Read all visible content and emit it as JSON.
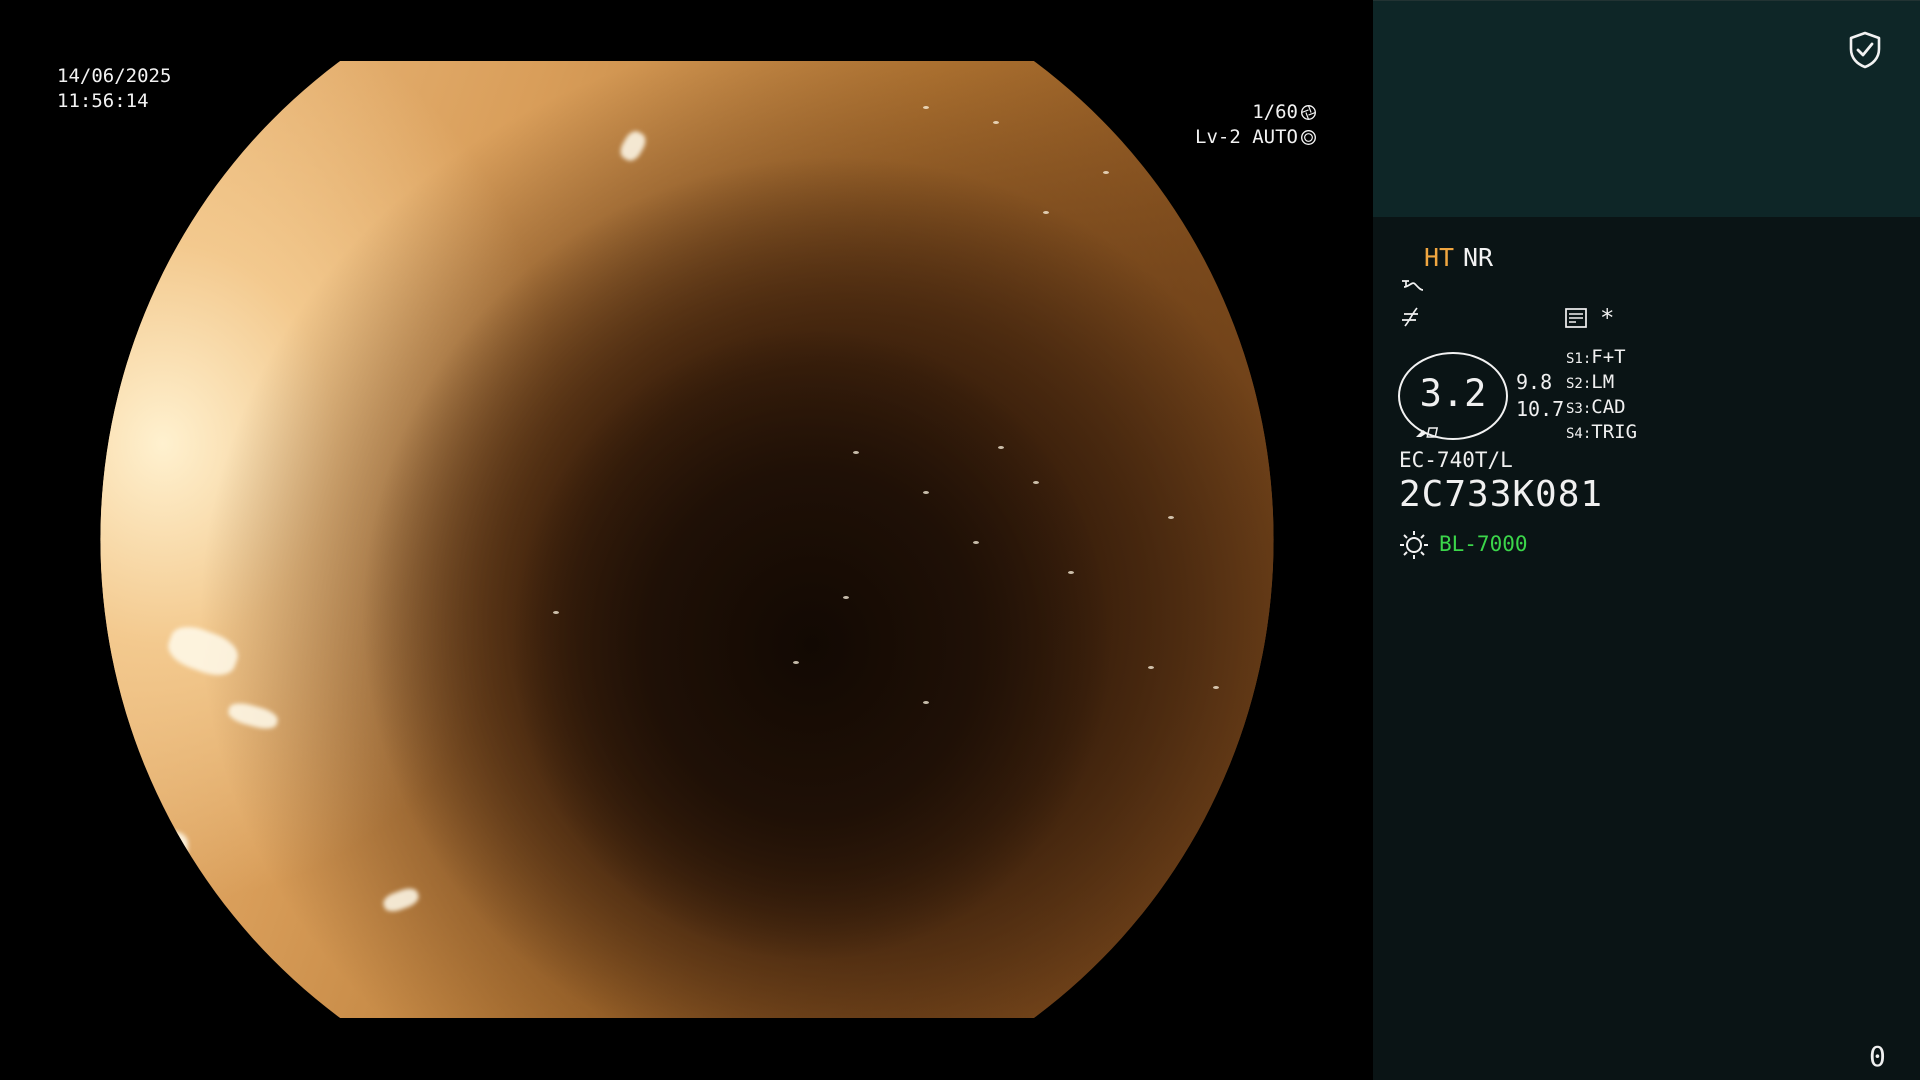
{
  "image_overlay": {
    "date": "14/06/2025",
    "time": "11:56:14",
    "shutter": "1/60",
    "iris": "Lv-2 AUTO"
  },
  "panel": {
    "header_icon": "shield-check-icon",
    "enhancements": {
      "ht": "HT",
      "nr": "NR",
      "ht_color": "#f0a640"
    },
    "icons": [
      "tone-curve-icon",
      "structure-curve-icon",
      "memo-icon"
    ],
    "star": "*",
    "zoom": {
      "value": "3.2",
      "side_top": "9.8",
      "side_bottom": "10.7"
    },
    "switches": [
      {
        "key": "S1",
        "value": "F+T"
      },
      {
        "key": "S2",
        "value": "LM"
      },
      {
        "key": "S3",
        "value": "CAD"
      },
      {
        "key": "S4",
        "value": "TRIG"
      }
    ],
    "scope_model": "EC-740T/L",
    "scope_serial": "2C733K081",
    "light_source": {
      "icon": "light-source-icon",
      "model": "BL-7000",
      "color": "#3bd64a"
    },
    "counter": "0"
  },
  "colors": {
    "panel_bg": "#0a1415",
    "header_bg": "#0e2627"
  }
}
